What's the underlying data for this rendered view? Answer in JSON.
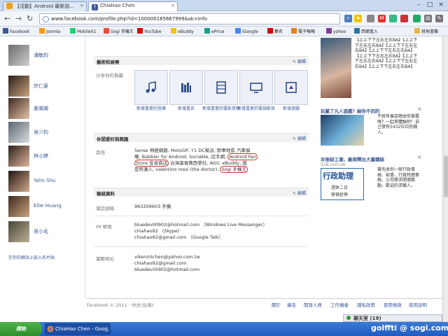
{
  "browser": {
    "tabs": [
      {
        "label": "【活動】Android 最新說..."
      },
      {
        "label": "ChiaHao Chen"
      }
    ],
    "url": "www.facebook.com/profile.php?id=100000165667999&sk=info",
    "bookmarks": [
      "Facebook",
      "Joomla",
      "Mobile01",
      "Sogi 手機王",
      "YouTube",
      "eBuddy",
      "ePrice",
      "iGoogle",
      "集名",
      "電子報報",
      "yahoo",
      "西網進入",
      "其他書籤"
    ]
  },
  "friends": [
    {
      "name": "潘敏鈞"
    },
    {
      "name": "許仁豪"
    },
    {
      "name": "姜瀚瀚"
    },
    {
      "name": "吳少鈞"
    },
    {
      "name": "林小婷"
    },
    {
      "name": "Yalin Shu"
    },
    {
      "name": "Ellie Huang"
    },
    {
      "name": "孫小毛"
    }
  ],
  "left_link": "在你的網站上嵌入名片貼",
  "arts": {
    "title": "藝術和娛樂",
    "edit": "編輯",
    "prompt": "分享你的典藏",
    "items": [
      {
        "caption": "新增喜愛的音樂"
      },
      {
        "caption": "新增書名"
      },
      {
        "caption": "新增喜愛的電影資料"
      },
      {
        "caption": "新增喜愛的電視節目"
      },
      {
        "caption": "新增遊戲"
      }
    ]
  },
  "activities": {
    "title": "休閒愛好與興趣",
    "edit": "編輯",
    "label": "其他",
    "line1": "Sense 神經網路, MotoGP, Y1 DC幫派, 即軍地區 汽車俱",
    "line2": "樂, Babbler for Android, Sociable, 控手網, ",
    "hl1": "Android Fan",
    "line3_hl": "Store 安卓商店",
    "line3": " 台灣基督教西學社, AGV, eBuddy, 我",
    "line4": "是阿蓮人, valentino rossi (the doctor), ",
    "hl3": "Sogi 手機王"
  },
  "contact": {
    "title": "聯絡資料",
    "edit": "編輯",
    "phone_label": "電話號碼",
    "phone": "963209603 手機",
    "im_label": "IM 帳號",
    "im1": "bluedevil0902@hotmail.com （Windows Live Messenger）",
    "im2": "chiahao92 （Skype）",
    "im3": "chiahao92@gmail.com （Google Talk）",
    "email_label": "電郵地址",
    "email1": "vikenintchen@yahoo.com.tw",
    "email2": "chiahao92@gmail.com",
    "email3": "bluedevil0902@hotmail.com"
  },
  "ads": {
    "ad1_text": "【上上下下左右左右BA】【上上下下左右左右BA】【上上下下左右左右BA】【上上下下左右左右BA】【上上下下左右左右BA】【上上下下左右左右BA】【上上下下左右左右BA】【上上下下左右左右BA】",
    "ad2_title": "玩膩了凡人遊戲？給你不同的",
    "ad2_text": "不就有善惡總由你掌握嗎？一起來體驗吧！自己發有5432位白色戰人。",
    "ad3_title": "年後缺工潮，廠商釋出大量職缺",
    "ad3_url": "518.com.tw",
    "ad3_banner": "行政助理",
    "ad3_sub1": "週休二日",
    "ad3_sub2": "勞保延伸",
    "ad3_text": "搶先收到一般行政事務、秘書、行政院總事務、公司需求開價獎勵，歡迎的求職人。"
  },
  "footer": {
    "copyright": "Facebook © 2011 · 中文(台灣)",
    "links": [
      "關於",
      "廣告",
      "開發人員",
      "工作機會",
      "隱私政策",
      "使用條款",
      "使用說明"
    ]
  },
  "chat": {
    "label": "聊天室 (19)"
  },
  "taskbar": {
    "start": "開始",
    "task": "ChiaHao Chen - Goog...",
    "watermark": "golffti @ sogi.com.tw"
  },
  "colors": {
    "fb_blue": "#3b5998",
    "highlight_red": "#c0392b",
    "taskbar_blue": "#245edb"
  }
}
